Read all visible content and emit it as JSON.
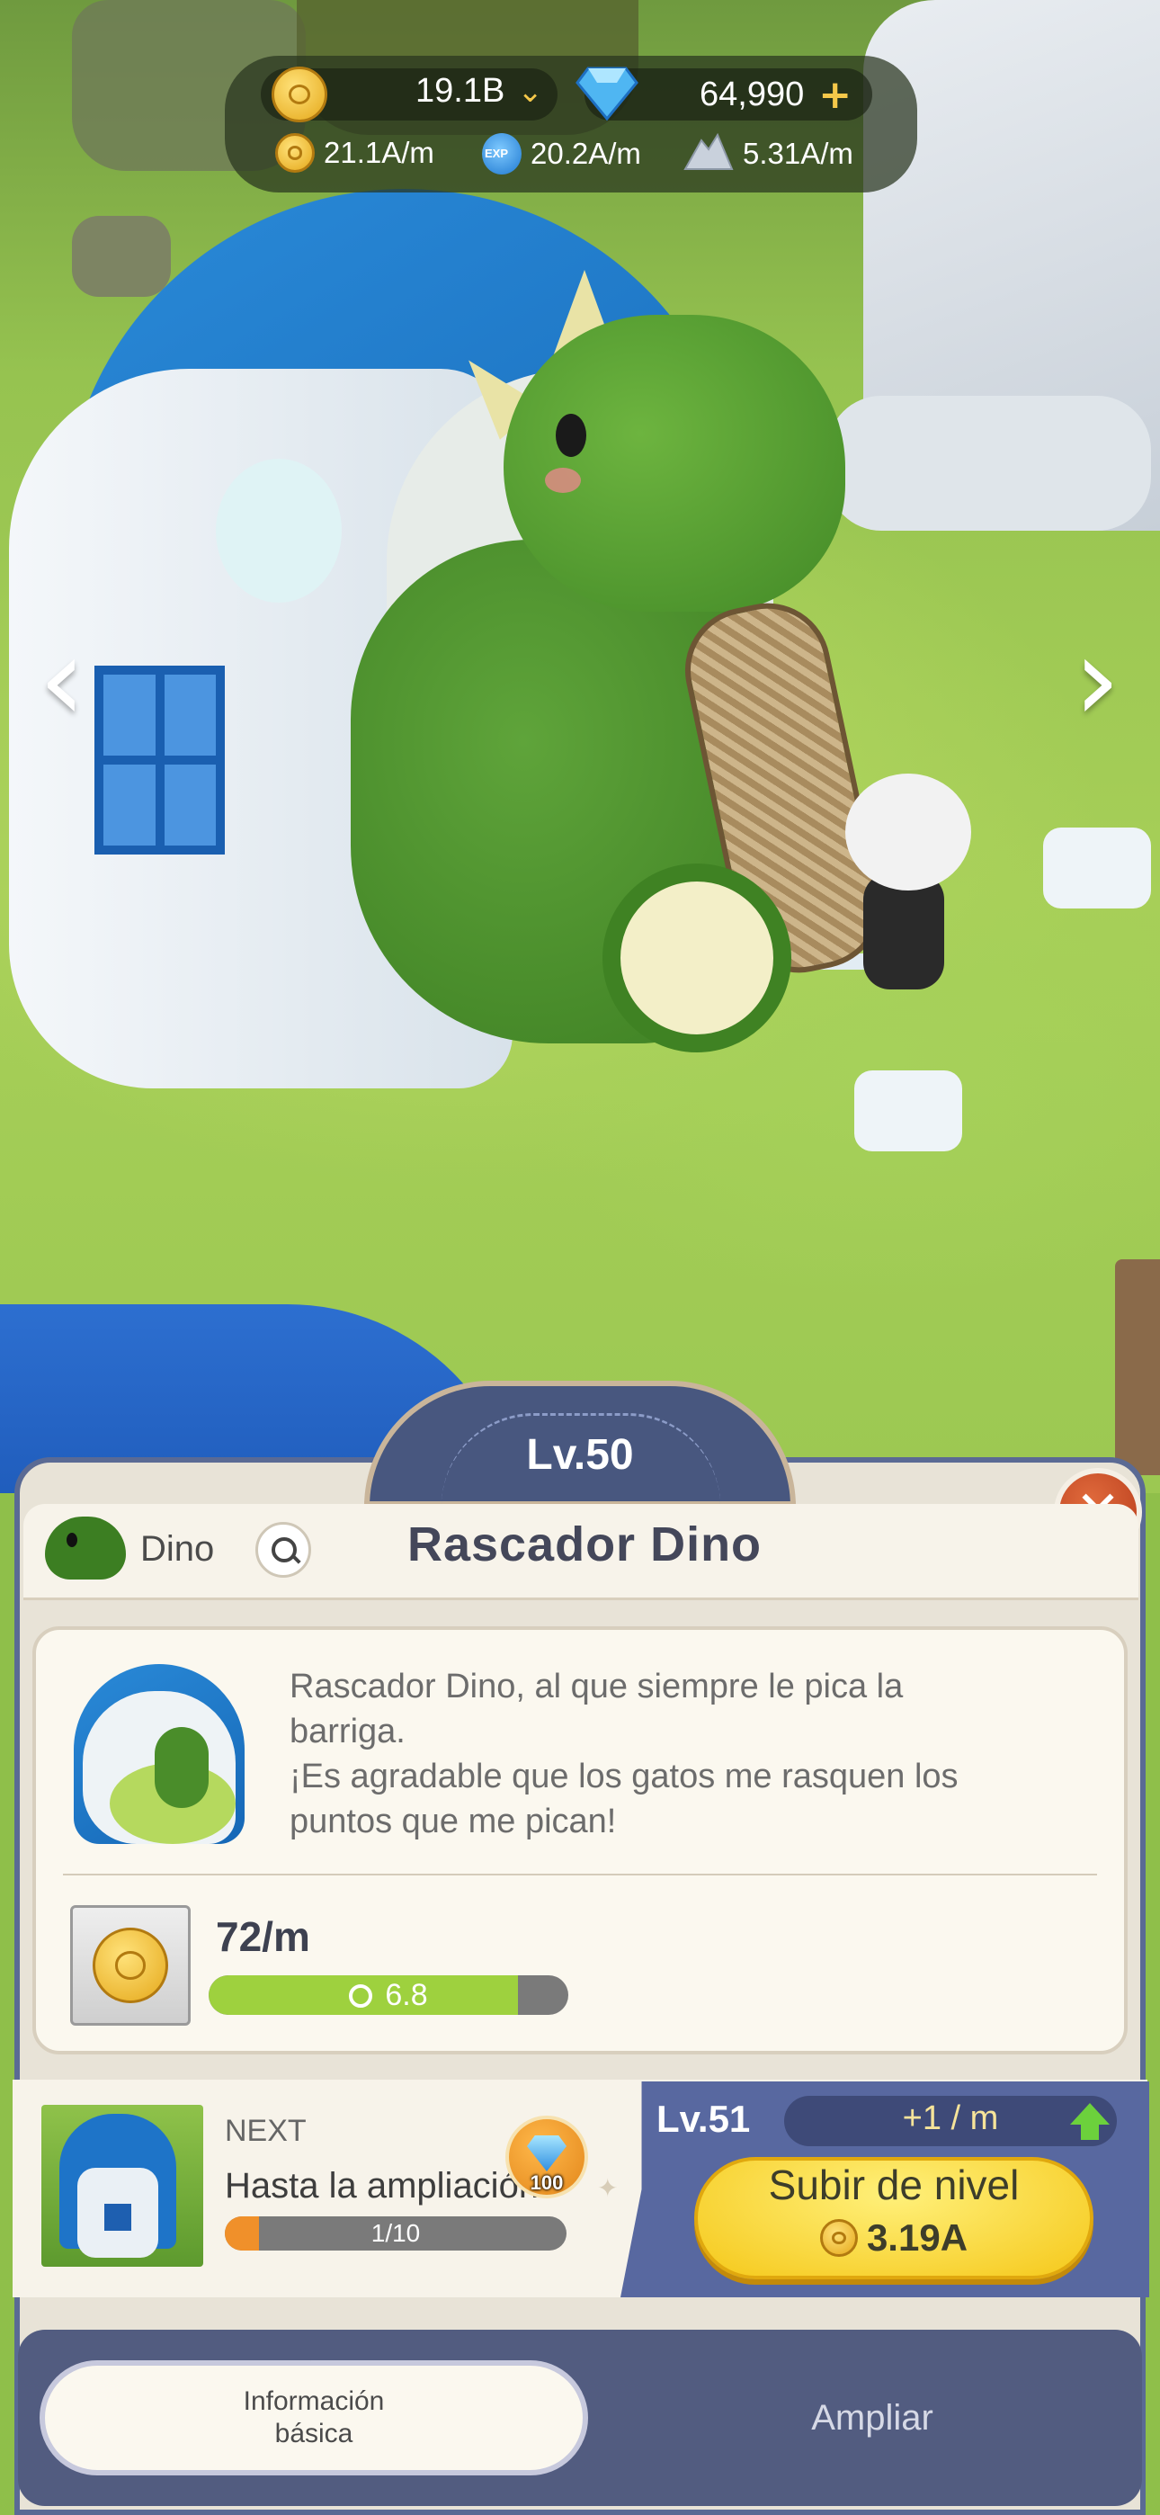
{
  "resources": {
    "coins": "19.1B",
    "gems": "64,990",
    "coin_rate": "21.1A/m",
    "exp_badge": "EXP",
    "exp_rate": "20.2A/m",
    "mineral_rate": "5.31A/m"
  },
  "nav": {
    "prev": "‹",
    "next": "›"
  },
  "building": {
    "level": "Lv.50",
    "category": "Dino",
    "title": "Rascador Dino",
    "description_lines": [
      "Rascador Dino, al que siempre le pica la",
      "barriga.",
      "¡Es agradable que los gatos me rasquen los",
      "puntos que me pican!"
    ],
    "production_rate": "72/m",
    "timer": "6.8",
    "timer_progress": 0.86
  },
  "upgrade": {
    "next_label": "NEXT",
    "goal": "Hasta la ampliación",
    "goal_progress_text": "1/10",
    "goal_progress": 0.1,
    "reward_amount": "100",
    "next_level": "Lv.51",
    "gain": "+1 / m",
    "button_label": "Subir de nivel",
    "cost": "3.19A"
  },
  "tabs": {
    "basic_line1": "Información",
    "basic_line2": "básica",
    "expand": "Ampliar"
  },
  "close_symbol": "✕",
  "colors": {
    "panel_accent": "#5868a0",
    "levelup_button": "#f5c81a",
    "close_button": "#c94a26",
    "timer_fill": "#9ed13e",
    "goal_fill": "#f0902a"
  }
}
